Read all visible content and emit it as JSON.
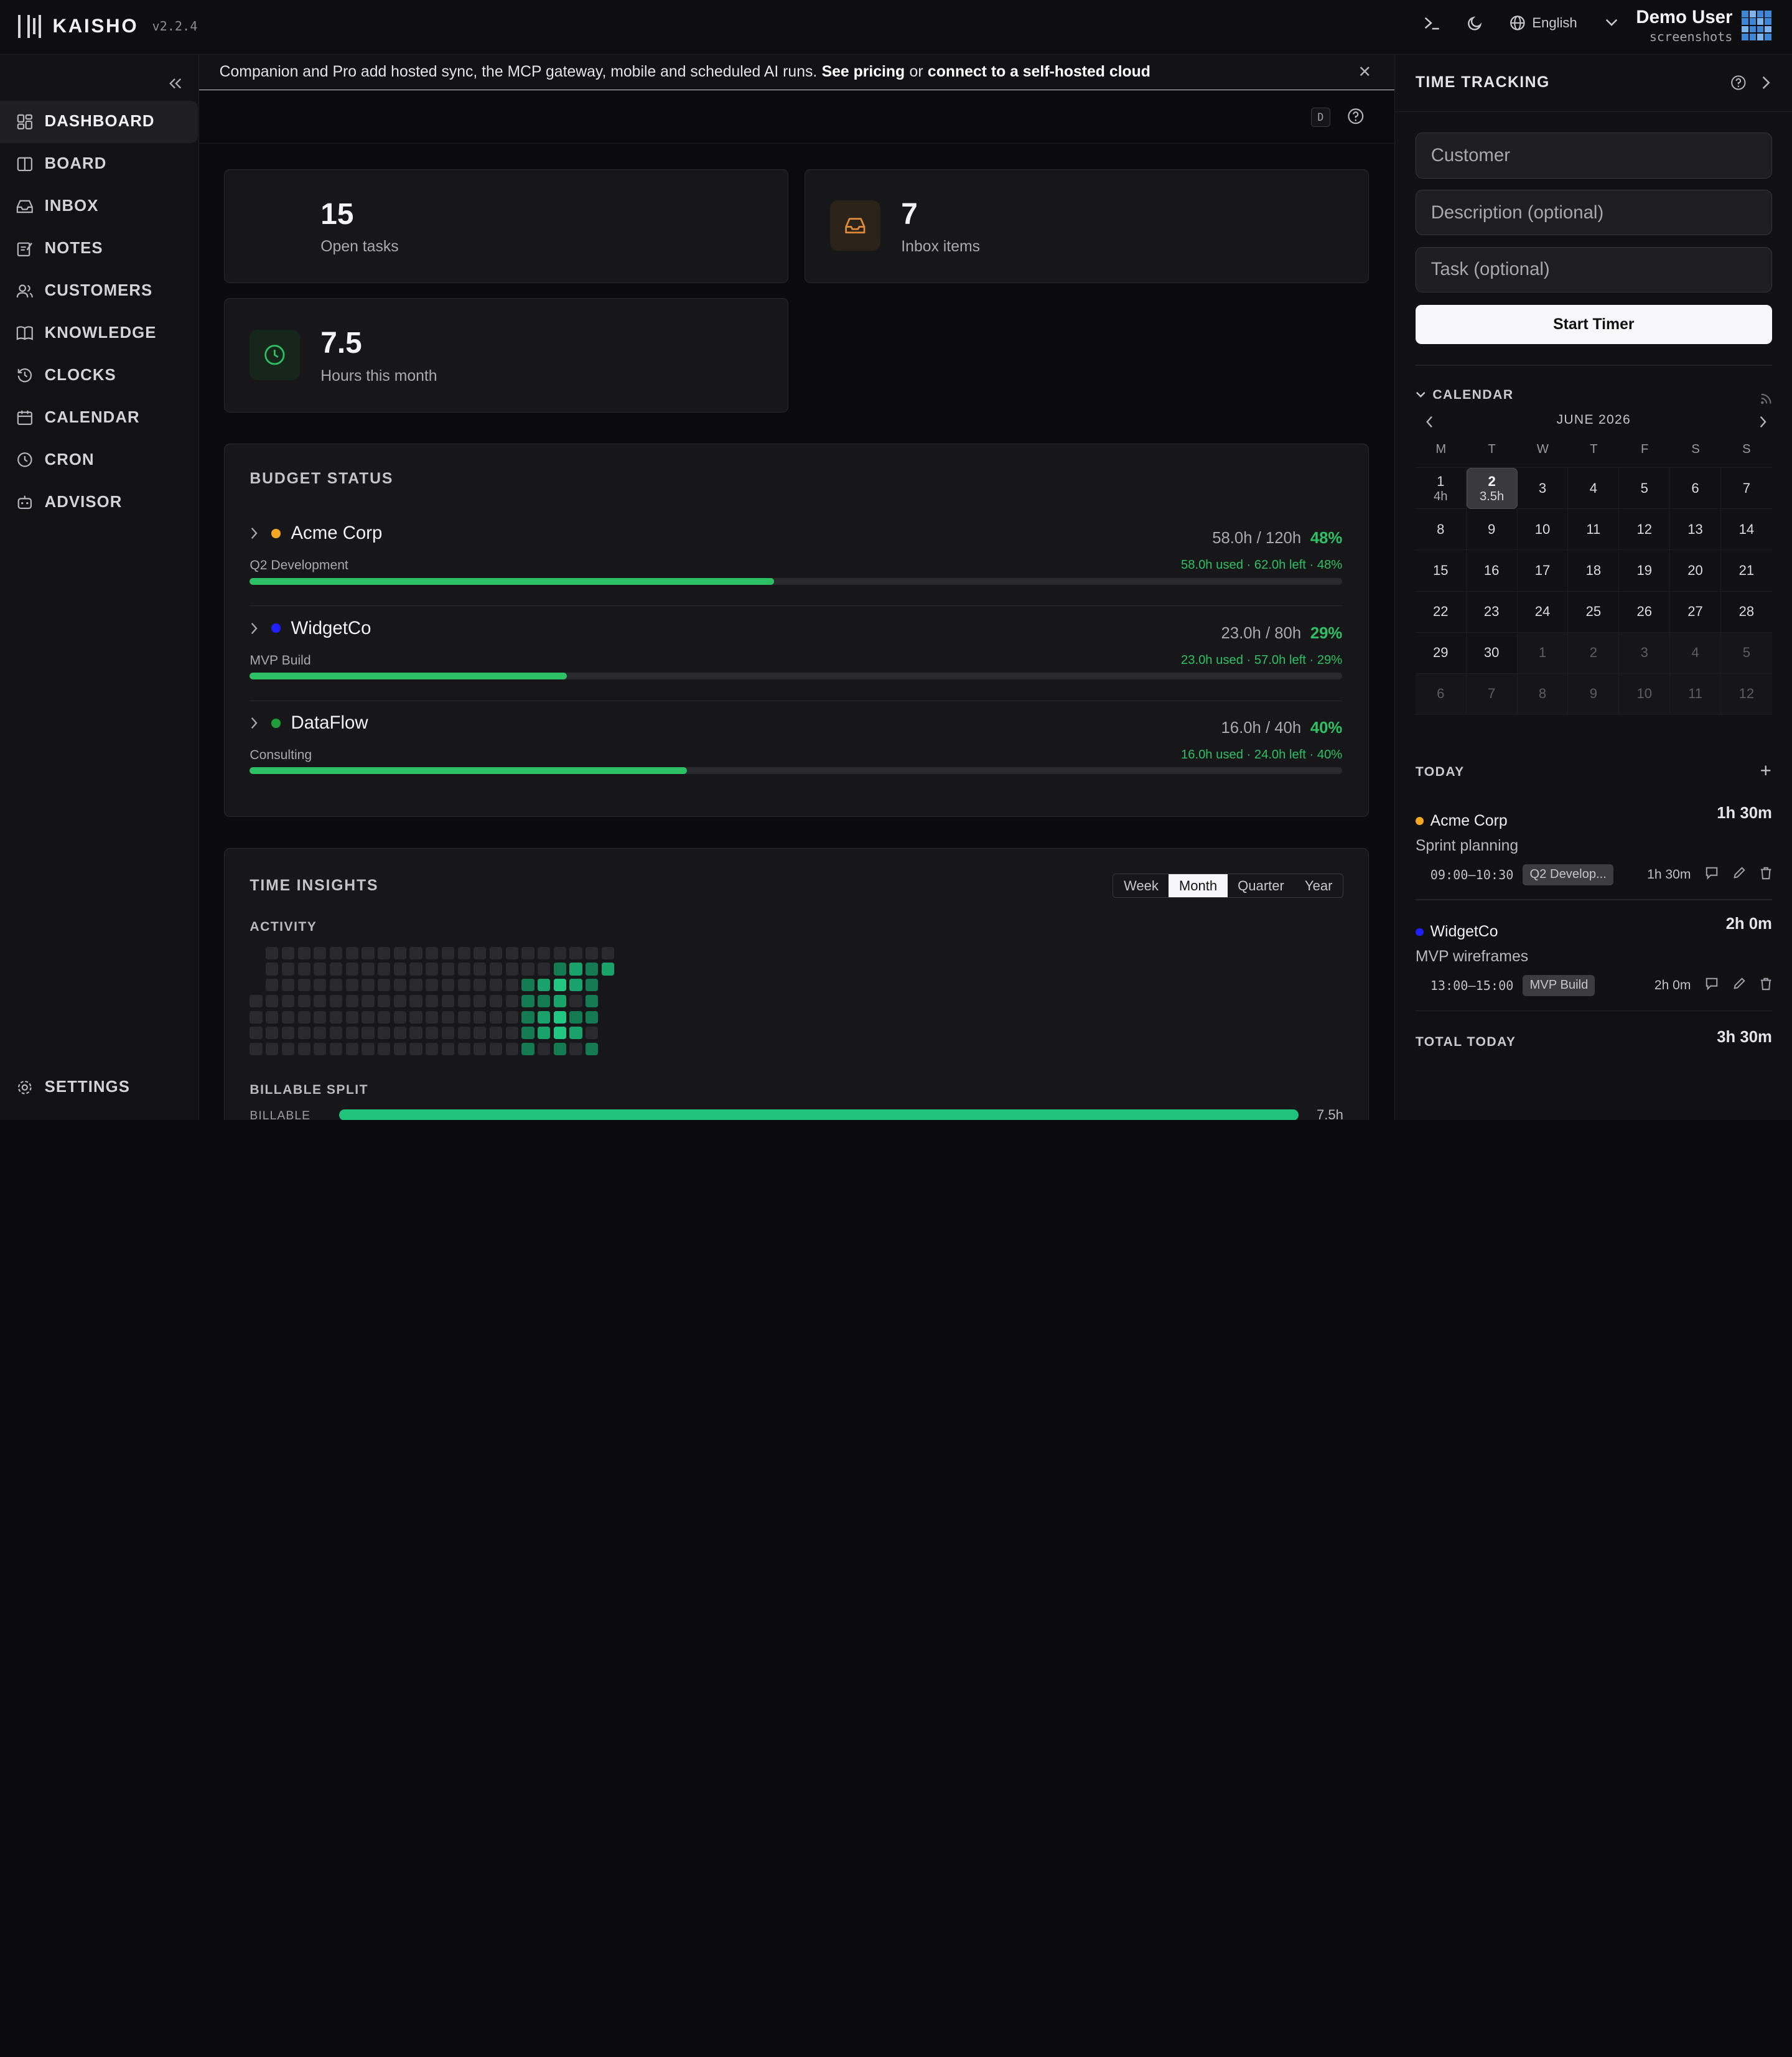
{
  "app": {
    "name": "KAISHO",
    "version": "v2.2.4"
  },
  "topbar": {
    "language": "English"
  },
  "user": {
    "name": "Demo User",
    "subtitle": "screenshots"
  },
  "sidebar": {
    "items": [
      {
        "label": "DASHBOARD",
        "icon": "dashboard-icon"
      },
      {
        "label": "BOARD",
        "icon": "board-icon"
      },
      {
        "label": "INBOX",
        "icon": "inbox-icon"
      },
      {
        "label": "NOTES",
        "icon": "notes-icon"
      },
      {
        "label": "CUSTOMERS",
        "icon": "customers-icon"
      },
      {
        "label": "KNOWLEDGE",
        "icon": "book-icon"
      },
      {
        "label": "CLOCKS",
        "icon": "history-icon"
      },
      {
        "label": "CALENDAR",
        "icon": "calendar-icon"
      },
      {
        "label": "CRON",
        "icon": "clock-icon"
      },
      {
        "label": "ADVISOR",
        "icon": "robot-icon"
      }
    ],
    "settings": "SETTINGS"
  },
  "banner": {
    "text": "Companion and Pro add hosted sync, the MCP gateway, mobile and scheduled AI runs.",
    "link1": "See pricing",
    "joiner": "or",
    "link2": "connect to a self-hosted cloud"
  },
  "subbar": {
    "shortcut": "D"
  },
  "stats": {
    "open_tasks": {
      "value": "15",
      "label": "Open tasks"
    },
    "inbox": {
      "value": "7",
      "label": "Inbox items"
    },
    "hours": {
      "value": "7.5",
      "label": "Hours this month"
    }
  },
  "colors": {
    "accent_green": "#2ec064",
    "inbox_orange": "#e08a3a",
    "acme": "#f5a623",
    "widgetco": "#1f1fff",
    "dataflow": "#1f9d3a"
  },
  "budget": {
    "title": "BUDGET STATUS",
    "rows": [
      {
        "name": "Acme Corp",
        "project": "Q2 Development",
        "hours": "58.0h / 120h",
        "pct": "48%",
        "detail": "58.0h used · 62.0h left · 48%",
        "fraction": 0.48
      },
      {
        "name": "WidgetCo",
        "project": "MVP Build",
        "hours": "23.0h / 80h",
        "pct": "29%",
        "detail": "23.0h used · 57.0h left · 29%",
        "fraction": 0.29
      },
      {
        "name": "DataFlow",
        "project": "Consulting",
        "hours": "16.0h / 40h",
        "pct": "40%",
        "detail": "16.0h used · 24.0h left · 40%",
        "fraction": 0.4
      }
    ]
  },
  "insights": {
    "title": "TIME INSIGHTS",
    "ranges": [
      "Week",
      "Month",
      "Quarter",
      "Year"
    ],
    "selected_range": "Month",
    "activity_label": "ACTIVITY",
    "billable_label": "BILLABLE SPLIT",
    "billable_row_label": "BILLABLE",
    "billable_value": "7.5h"
  },
  "time_tracking": {
    "title": "TIME TRACKING",
    "customer_placeholder": "Customer",
    "description_placeholder": "Description (optional)",
    "task_placeholder": "Task (optional)",
    "start_label": "Start Timer"
  },
  "calendar": {
    "title": "CALENDAR",
    "month": "JUNE 2026",
    "dow": [
      "M",
      "T",
      "W",
      "T",
      "F",
      "S",
      "S"
    ],
    "days": [
      {
        "d": "1",
        "h": "4h"
      },
      {
        "d": "2",
        "h": "3.5h",
        "today": true
      },
      {
        "d": "3"
      },
      {
        "d": "4"
      },
      {
        "d": "5"
      },
      {
        "d": "6"
      },
      {
        "d": "7"
      },
      {
        "d": "8"
      },
      {
        "d": "9"
      },
      {
        "d": "10"
      },
      {
        "d": "11"
      },
      {
        "d": "12"
      },
      {
        "d": "13"
      },
      {
        "d": "14"
      },
      {
        "d": "15"
      },
      {
        "d": "16"
      },
      {
        "d": "17"
      },
      {
        "d": "18"
      },
      {
        "d": "19"
      },
      {
        "d": "20"
      },
      {
        "d": "21"
      },
      {
        "d": "22"
      },
      {
        "d": "23"
      },
      {
        "d": "24"
      },
      {
        "d": "25"
      },
      {
        "d": "26"
      },
      {
        "d": "27"
      },
      {
        "d": "28"
      },
      {
        "d": "29"
      },
      {
        "d": "30"
      },
      {
        "d": "1",
        "muted": true
      },
      {
        "d": "2",
        "muted": true
      },
      {
        "d": "3",
        "muted": true
      },
      {
        "d": "4",
        "muted": true
      },
      {
        "d": "5",
        "muted": true
      },
      {
        "d": "6",
        "muted": true
      },
      {
        "d": "7",
        "muted": true
      },
      {
        "d": "8",
        "muted": true
      },
      {
        "d": "9",
        "muted": true
      },
      {
        "d": "10",
        "muted": true
      },
      {
        "d": "11",
        "muted": true
      },
      {
        "d": "12",
        "muted": true
      }
    ]
  },
  "today": {
    "title": "TODAY",
    "entries": [
      {
        "customer": "Acme Corp",
        "duration": "1h 30m",
        "description": "Sprint planning",
        "time": "09:00–10:30",
        "tag": "Q2 Develop...",
        "meta_duration": "1h 30m"
      },
      {
        "customer": "WidgetCo",
        "duration": "2h 0m",
        "description": "MVP wireframes",
        "time": "13:00–15:00",
        "tag": "MVP Build",
        "meta_duration": "2h 0m"
      }
    ],
    "total_label": "TOTAL TODAY",
    "total_value": "3h 30m"
  }
}
